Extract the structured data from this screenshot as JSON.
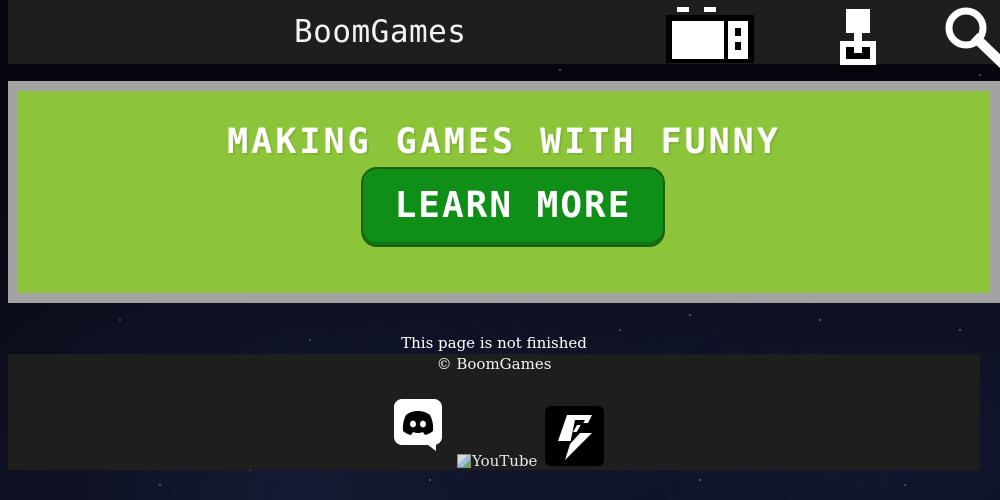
{
  "header": {
    "title": "BoomGames",
    "icons": [
      "console-icon",
      "joystick-icon",
      "search-icon"
    ]
  },
  "hero": {
    "heading": "Making games with funny",
    "button_label": "Learn more",
    "background_color": "#8cc43a",
    "button_color": "#0f8f17"
  },
  "notice": {
    "text": "This page is not finished"
  },
  "footer": {
    "copyright": "© BoomGames",
    "links": [
      {
        "name": "Discord",
        "icon": "discord-icon"
      },
      {
        "name": "YouTube",
        "alt_text": "YouTube",
        "icon": "broken-image-icon"
      },
      {
        "name": "Game Jolt",
        "icon": "gamejolt-icon"
      }
    ]
  },
  "colors": {
    "bar": "#1e1e1e",
    "page_background": "#05060d",
    "hero_border": "#a2a2a2"
  }
}
